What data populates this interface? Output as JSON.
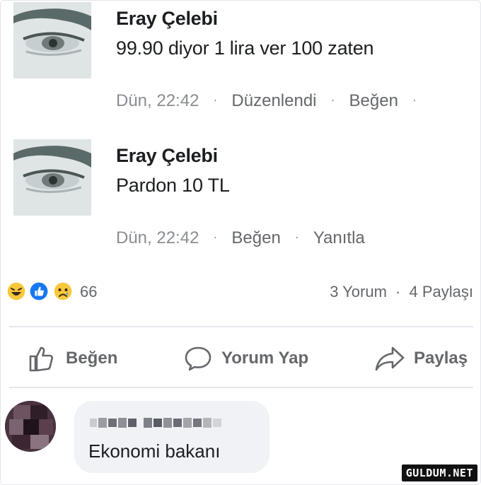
{
  "comments": [
    {
      "author": "Eray Çelebi",
      "text": "99.90 diyor 1 lira ver 100 zaten",
      "time": "Dün, 22:42",
      "edited": "Düzenlendi",
      "like": "Beğen",
      "trailing_dot": "·"
    },
    {
      "author": "Eray Çelebi",
      "text": "Pardon 10 TL",
      "time": "Dün, 22:42",
      "like": "Beğen",
      "reply": "Yanıtla"
    }
  ],
  "stats": {
    "reaction_count": "66",
    "comments": "3 Yorum",
    "shares": "4 Paylaşı",
    "separator": "·",
    "reaction_icons": [
      "laugh-emoji",
      "like-emoji",
      "sad-emoji"
    ]
  },
  "actions": {
    "like": "Beğen",
    "comment": "Yorum Yap",
    "share": "Paylaş"
  },
  "reply": {
    "text": "Ekonomi bakanı"
  },
  "watermark": "GULDUM.NET",
  "colors": {
    "text": "#1c1e21",
    "meta": "#8a8d91",
    "action": "#65676b",
    "bubble": "#f0f2f5",
    "like_blue": "#1877f2"
  }
}
